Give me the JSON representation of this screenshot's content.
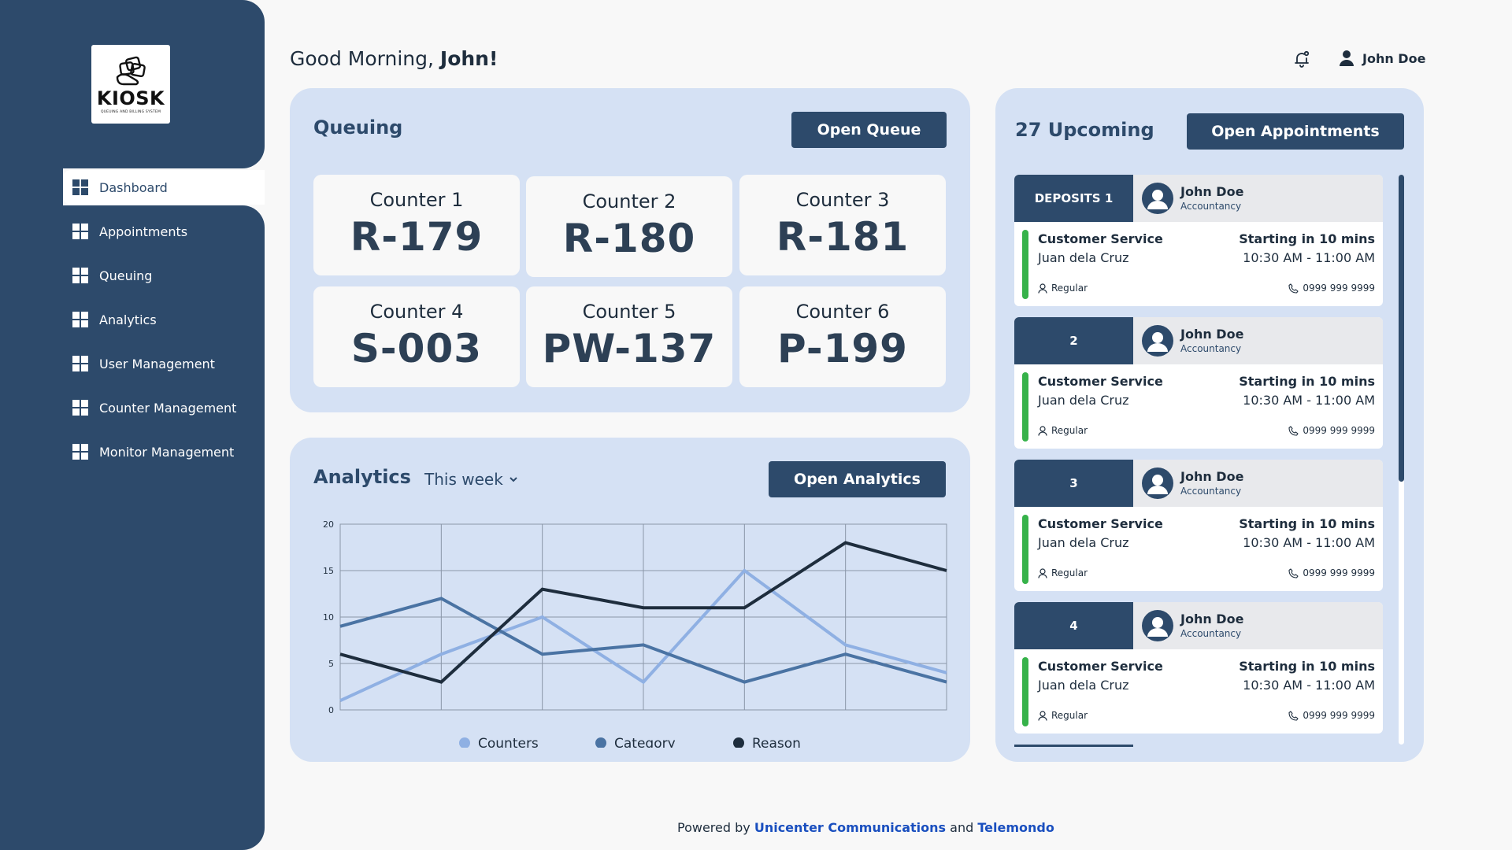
{
  "brand": {
    "logo_title": "KIOSK",
    "logo_subtitle": "QUEUING AND BILLING SYSTEM"
  },
  "sidebar": {
    "items": [
      {
        "label": "Dashboard",
        "icon": "dashboard-icon",
        "active": true
      },
      {
        "label": "Appointments",
        "icon": "dashboard-icon"
      },
      {
        "label": "Queuing",
        "icon": "dashboard-icon"
      },
      {
        "label": "Analytics",
        "icon": "dashboard-icon"
      },
      {
        "label": "User Management",
        "icon": "dashboard-icon"
      },
      {
        "label": "Counter Management",
        "icon": "dashboard-icon"
      },
      {
        "label": "Monitor Management",
        "icon": "dashboard-icon"
      }
    ]
  },
  "header": {
    "greeting_prefix": "Good Morning,",
    "greeting_name": "John!",
    "user_name": "John Doe"
  },
  "queuing": {
    "title": "Queuing",
    "button": "Open Queue",
    "counters": [
      {
        "name": "Counter 1",
        "value": "R-179"
      },
      {
        "name": "Counter 2",
        "value": "R-180"
      },
      {
        "name": "Counter 3",
        "value": "R-181"
      },
      {
        "name": "Counter 4",
        "value": "S-003"
      },
      {
        "name": "Counter 5",
        "value": "PW-137"
      },
      {
        "name": "Counter 6",
        "value": "P-199"
      }
    ]
  },
  "analytics": {
    "title": "Analytics",
    "range": "This week",
    "button": "Open Analytics"
  },
  "chart_data": {
    "type": "line",
    "x": [
      0,
      1,
      2,
      3,
      4,
      5,
      6
    ],
    "ylim": [
      0,
      20
    ],
    "yticks": [
      0,
      5,
      10,
      15,
      20
    ],
    "grid": true,
    "legend_position": "bottom",
    "series": [
      {
        "name": "Counters",
        "color": "#8fb0e3",
        "values": [
          1,
          6,
          10,
          3,
          15,
          7,
          4
        ]
      },
      {
        "name": "Category",
        "color": "#4a73a3",
        "values": [
          9,
          12,
          6,
          7,
          3,
          6,
          3
        ]
      },
      {
        "name": "Reason",
        "color": "#1e2d3d",
        "values": [
          6,
          3,
          13,
          11,
          11,
          18,
          15
        ]
      }
    ]
  },
  "appointments": {
    "title": "27 Upcoming",
    "button": "Open Appointments",
    "items": [
      {
        "badge": "DEPOSITS 1",
        "name": "John Doe",
        "dept": "Accountancy",
        "service": "Customer Service",
        "person": "Juan dela Cruz",
        "start": "Starting in 10 mins",
        "time": "10:30 AM - 11:00 AM",
        "type": "Regular",
        "phone": "0999 999 9999"
      },
      {
        "badge": "2",
        "name": "John Doe",
        "dept": "Accountancy",
        "service": "Customer Service",
        "person": "Juan dela Cruz",
        "start": "Starting in 10 mins",
        "time": "10:30 AM - 11:00 AM",
        "type": "Regular",
        "phone": "0999 999 9999"
      },
      {
        "badge": "3",
        "name": "John Doe",
        "dept": "Accountancy",
        "service": "Customer Service",
        "person": "Juan dela Cruz",
        "start": "Starting in 10 mins",
        "time": "10:30 AM - 11:00 AM",
        "type": "Regular",
        "phone": "0999 999 9999"
      },
      {
        "badge": "4",
        "name": "John Doe",
        "dept": "Accountancy",
        "service": "Customer Service",
        "person": "Juan dela Cruz",
        "start": "Starting in 10 mins",
        "time": "10:30 AM - 11:00 AM",
        "type": "Regular",
        "phone": "0999 999 9999"
      }
    ]
  },
  "footer": {
    "prefix": "Powered by",
    "link1": "Unicenter Communications",
    "and": "and",
    "link2": "Telemondo"
  },
  "colors": {
    "primary": "#2d4a6b",
    "panel": "#d5e1f4",
    "status_green": "#36b24a",
    "link": "#1a4fbf"
  }
}
